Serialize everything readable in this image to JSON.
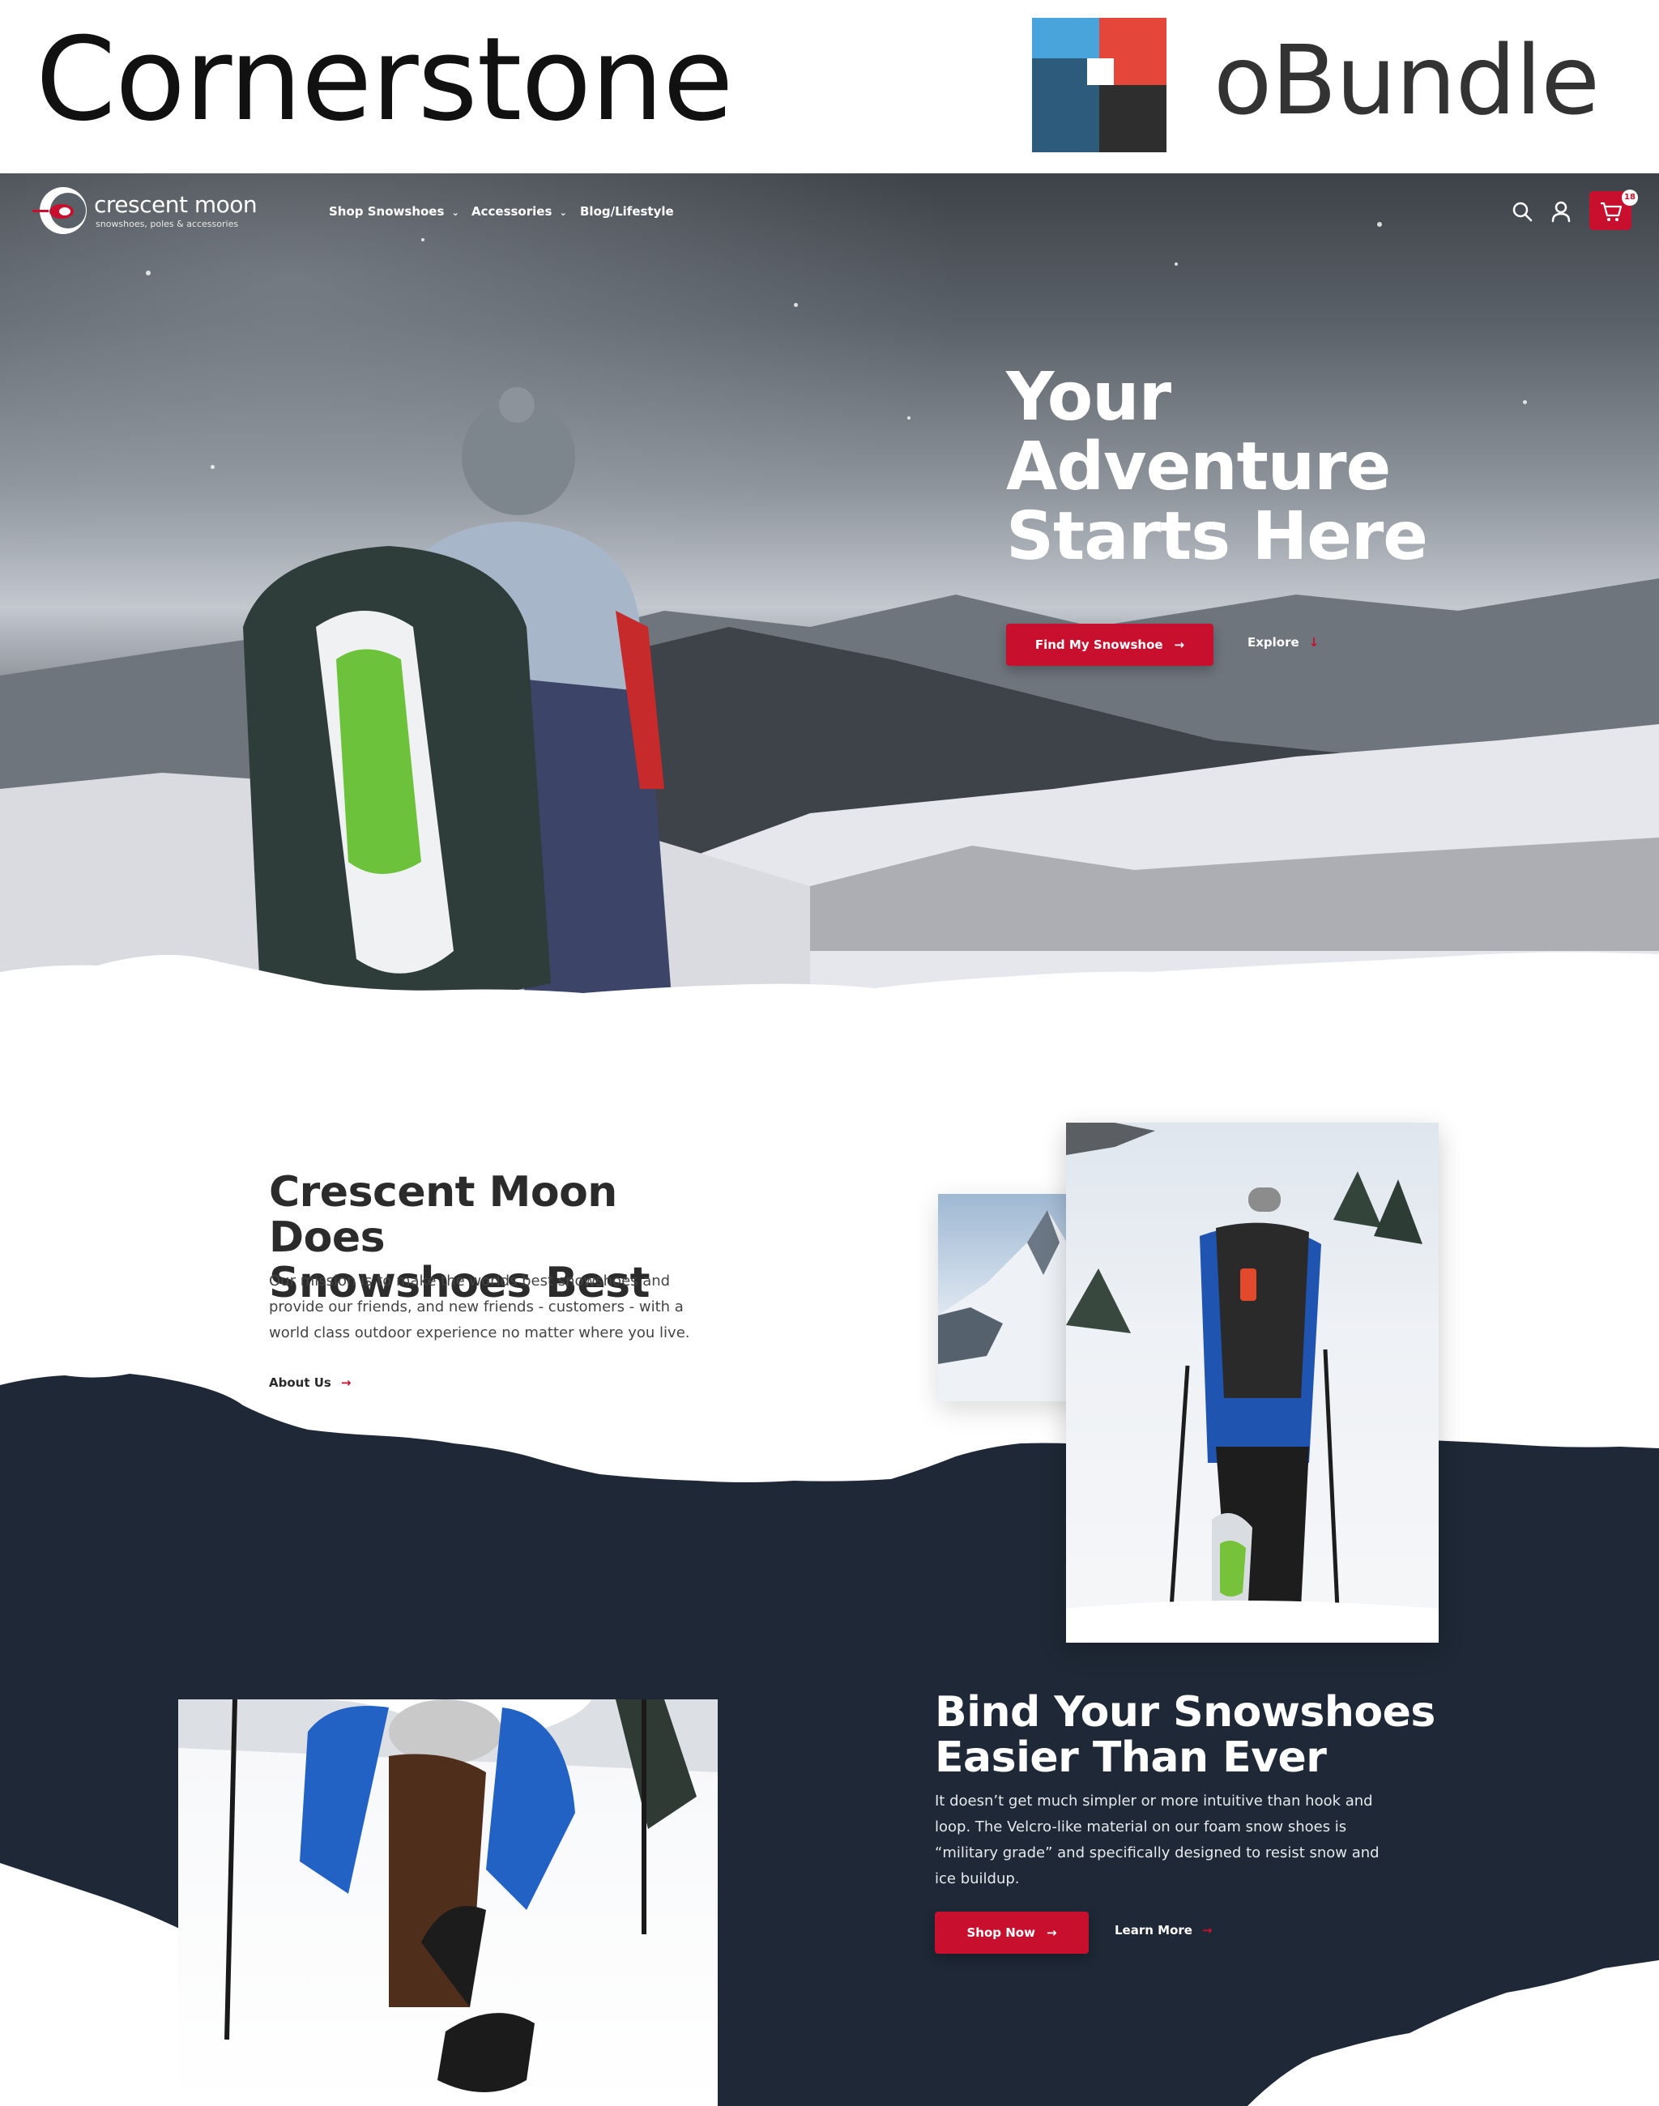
{
  "banner": {
    "title": "Cornerstone",
    "brand": "oBundle"
  },
  "site": {
    "logo_name": "crescent moon",
    "logo_tagline": "snowshoes, poles & accessories",
    "nav": [
      {
        "label": "Shop Snowshoes"
      },
      {
        "label": "Accessories"
      },
      {
        "label": "Blog/Lifestyle"
      }
    ],
    "cart_count": "18"
  },
  "hero": {
    "heading_line1": "Your",
    "heading_line2": "Adventure",
    "heading_line3": "Starts Here",
    "primary_cta": "Find My Snowshoe",
    "secondary_cta": "Explore"
  },
  "about": {
    "title_line1": "Crescent Moon Does",
    "title_line2": "Snowshoes Best",
    "body": "Our mission is to make the worlds best snowshoes and provide our friends, and new friends - customers - with a world class outdoor experience no matter where you live.",
    "link": "About Us"
  },
  "binding": {
    "title_line1": "Bind Your Snowshoes",
    "title_line2": "Easier Than Ever",
    "body": "It doesn’t get much simpler or more intuitive than hook and loop. The Velcro-like material on our foam snow shoes is “military grade” and specifically designed to resist snow and ice buildup.",
    "primary_cta": "Shop Now",
    "secondary_cta": "Learn More"
  },
  "colors": {
    "brand_red": "#c8102e",
    "navy": "#1e2836",
    "text_dark": "#2b2b2b"
  }
}
